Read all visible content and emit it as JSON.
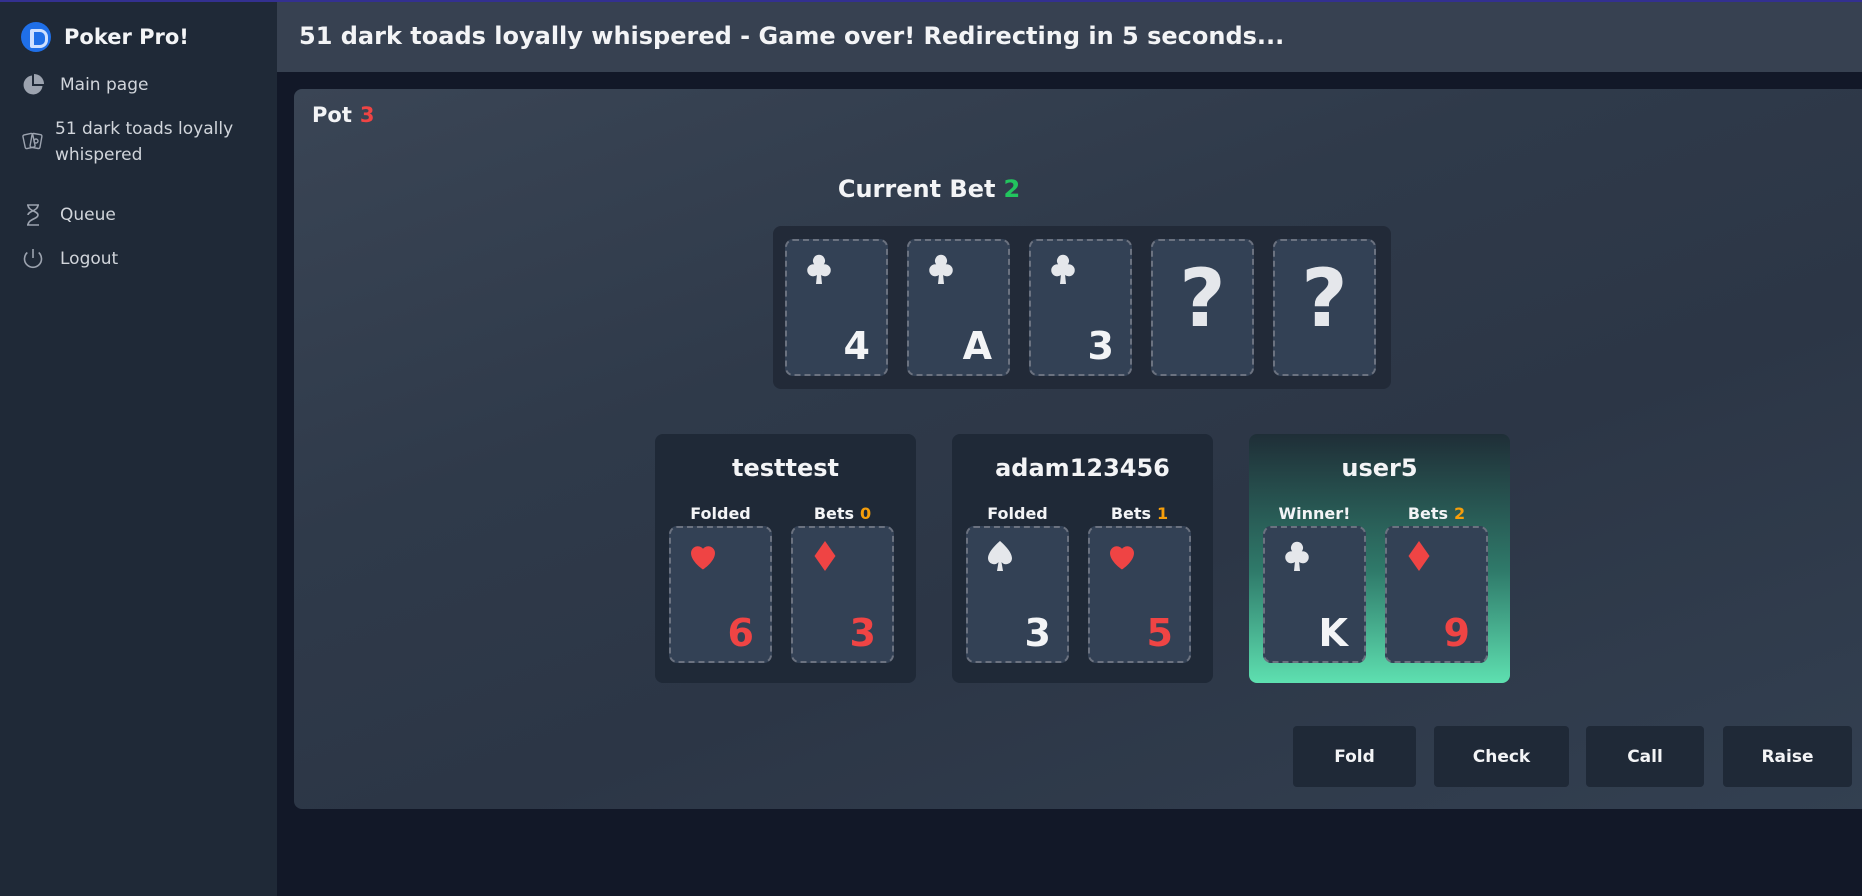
{
  "app": {
    "name": "Poker Pro!"
  },
  "sidebar": {
    "items": [
      {
        "label": "Main page",
        "icon": "pie-chart-icon"
      },
      {
        "label": "51 dark toads loyally whispered",
        "icon": "cards-icon"
      },
      {
        "label": "Queue",
        "icon": "hourglass-icon"
      },
      {
        "label": "Logout",
        "icon": "power-icon"
      }
    ]
  },
  "header": {
    "title": "51 dark toads loyally whispered - Game over! Redirecting in 5 seconds..."
  },
  "table": {
    "pot_label": "Pot",
    "pot_value": "3",
    "current_bet_label": "Current Bet",
    "current_bet_value": "2",
    "board": [
      {
        "suit": "clubs",
        "rank": "4"
      },
      {
        "suit": "clubs",
        "rank": "A"
      },
      {
        "suit": "clubs",
        "rank": "3"
      },
      {
        "hidden": true,
        "symbol": "?"
      },
      {
        "hidden": true,
        "symbol": "?"
      }
    ]
  },
  "players": [
    {
      "name": "testtest",
      "status": "Folded",
      "bets_label": "Bets",
      "bets": "0",
      "cards": [
        {
          "suit": "hearts",
          "rank": "6"
        },
        {
          "suit": "diamonds",
          "rank": "3"
        }
      ]
    },
    {
      "name": "adam123456",
      "status": "Folded",
      "bets_label": "Bets",
      "bets": "1",
      "cards": [
        {
          "suit": "spades",
          "rank": "3"
        },
        {
          "suit": "hearts",
          "rank": "5"
        }
      ]
    },
    {
      "name": "user5",
      "status": "Winner!",
      "bets_label": "Bets",
      "bets": "2",
      "winner": true,
      "cards": [
        {
          "suit": "clubs",
          "rank": "K"
        },
        {
          "suit": "diamonds",
          "rank": "9"
        }
      ]
    }
  ],
  "actions": {
    "fold": "Fold",
    "check": "Check",
    "call": "Call",
    "raise": "Raise"
  },
  "colors": {
    "red_suit": "#ef4444",
    "black_suit": "#e5e7eb",
    "pot": "#ef4444",
    "current_bet": "#22c55e",
    "bets": "#f59e0b",
    "winner_gradient": "#5ee0b0"
  }
}
